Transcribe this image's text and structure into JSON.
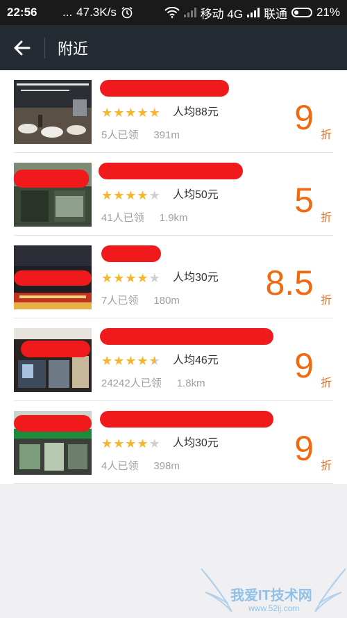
{
  "status_bar": {
    "time": "22:56",
    "dots": "...",
    "speed": "47.3K/s",
    "carrier1": "移动 4G",
    "carrier2": "联通",
    "battery": "21%"
  },
  "header": {
    "back_icon": "arrow-left-icon",
    "title": "附近"
  },
  "colors": {
    "header_bg": "#242b33",
    "discount": "#f26a0f",
    "star": "#f7b52c",
    "redaction": "#f0191b"
  },
  "items": [
    {
      "rating": 5,
      "avg": "人均88元",
      "claimed": "5人已领",
      "distance": "391m",
      "discount": "9",
      "unit": "折"
    },
    {
      "rating": 4,
      "avg": "人均50元",
      "claimed": "41人已领",
      "distance": "1.9km",
      "discount": "5",
      "unit": "折"
    },
    {
      "rating": 4,
      "avg": "人均30元",
      "claimed": "7人已领",
      "distance": "180m",
      "discount": "8.5",
      "unit": "折"
    },
    {
      "rating": 4.5,
      "avg": "人均46元",
      "claimed": "24242人已领",
      "distance": "1.8km",
      "discount": "9",
      "unit": "折"
    },
    {
      "rating": 4,
      "avg": "人均30元",
      "claimed": "4人已领",
      "distance": "398m",
      "discount": "9",
      "unit": "折"
    }
  ],
  "watermark": {
    "title": "我爱IT技术网",
    "url": "www.52ij.com"
  }
}
